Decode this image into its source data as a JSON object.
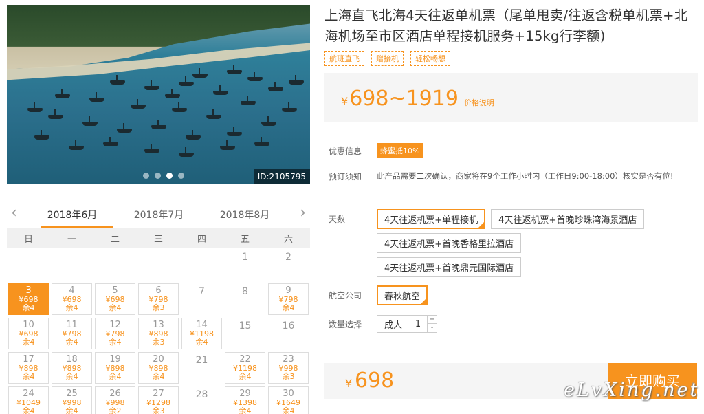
{
  "hero": {
    "id_label": "ID:2105795",
    "dots": 4,
    "active_dot": 2
  },
  "calendar": {
    "months": [
      "2018年6月",
      "2018年7月",
      "2018年8月"
    ],
    "active_month": 0,
    "weekdays": [
      "日",
      "一",
      "二",
      "三",
      "四",
      "五",
      "六"
    ],
    "days": [
      {
        "d": ""
      },
      {
        "d": ""
      },
      {
        "d": ""
      },
      {
        "d": ""
      },
      {
        "d": ""
      },
      {
        "d": "1"
      },
      {
        "d": "2"
      },
      {
        "d": "3",
        "p": "¥698",
        "s": "余4",
        "selected": true
      },
      {
        "d": "4",
        "p": "¥698",
        "s": "余4"
      },
      {
        "d": "5",
        "p": "¥698",
        "s": "余4"
      },
      {
        "d": "6",
        "p": "¥798",
        "s": "余3"
      },
      {
        "d": "7"
      },
      {
        "d": "8"
      },
      {
        "d": "9",
        "p": "¥798",
        "s": "余4"
      },
      {
        "d": "10",
        "p": "¥698",
        "s": "余4"
      },
      {
        "d": "11",
        "p": "¥798",
        "s": "余4"
      },
      {
        "d": "12",
        "p": "¥798",
        "s": "余4"
      },
      {
        "d": "13",
        "p": "¥898",
        "s": "余3"
      },
      {
        "d": "14",
        "p": "¥1198",
        "s": "余4"
      },
      {
        "d": "15"
      },
      {
        "d": "16"
      },
      {
        "d": "17",
        "p": "¥898",
        "s": "余4"
      },
      {
        "d": "18",
        "p": "¥898",
        "s": "余4"
      },
      {
        "d": "19",
        "p": "¥898",
        "s": "余4"
      },
      {
        "d": "20",
        "p": "¥898",
        "s": "余4"
      },
      {
        "d": "21"
      },
      {
        "d": "22",
        "p": "¥1198",
        "s": "余4"
      },
      {
        "d": "23",
        "p": "¥998",
        "s": "余3"
      },
      {
        "d": "24",
        "p": "¥1049",
        "s": "余4"
      },
      {
        "d": "25",
        "p": "¥998",
        "s": "余4"
      },
      {
        "d": "26",
        "p": "¥998",
        "s": "余2"
      },
      {
        "d": "27",
        "p": "¥1298",
        "s": "余3"
      },
      {
        "d": "28"
      },
      {
        "d": "29",
        "p": "¥1398",
        "s": "余4"
      },
      {
        "d": "30",
        "p": "¥1649",
        "s": "余4"
      }
    ]
  },
  "product": {
    "title": "上海直飞北海4天往返单机票（尾单甩卖/往返含税单机票+北海机场至市区酒店单程接机服务+15kg行李额)",
    "tags": [
      "航班直飞",
      "赠接机",
      "轻松畅想"
    ],
    "price_symbol": "¥",
    "price_range": "698~1919",
    "price_note": "价格说明"
  },
  "info": {
    "discount_label": "优惠信息",
    "discount_badge": "蜂蜜抵10%",
    "notice_label": "预订须知",
    "notice_text": "此产品需要二次确认，商家将在9个工作小时内（工作日9:00-18:00）核实是否有位!"
  },
  "options": {
    "days_label": "天数",
    "days": [
      "4天往返机票+单程接机",
      "4天往返机票+首晚珍珠湾海景酒店",
      "4天往返机票+首晚香格里拉酒店",
      "4天往返机票+首晚鼎元国际酒店"
    ],
    "airline_label": "航空公司",
    "airline": "春秋航空",
    "qty_label": "数量选择",
    "qty_type": "成人",
    "qty_value": "1",
    "plus": "+",
    "minus": "-"
  },
  "buy": {
    "symbol": "¥",
    "amount": "698",
    "button": "立即购买"
  },
  "watermark": "eLvXing.net",
  "colors": {
    "accent": "#f7931e"
  }
}
